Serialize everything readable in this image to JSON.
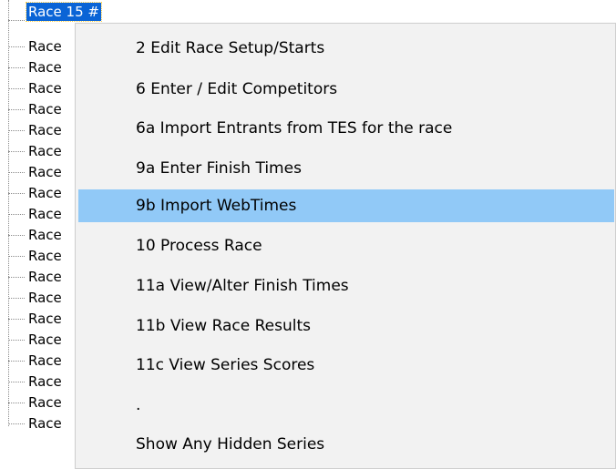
{
  "tree": {
    "selected_label": "Race 15 #",
    "item_label": "Race"
  },
  "context_menu": {
    "items": [
      {
        "label": "2  Edit Race Setup/Starts"
      },
      {
        "label": "6  Enter / Edit Competitors"
      },
      {
        "label": "6a  Import Entrants from TES for the race"
      },
      {
        "label": "9a  Enter Finish Times"
      },
      {
        "label": "9b Import WebTimes",
        "highlighted": true
      },
      {
        "label": "10  Process Race"
      },
      {
        "label": "11a  View/Alter Finish Times"
      },
      {
        "label": "11b  View Race Results"
      },
      {
        "label": "11c View Series Scores"
      },
      {
        "label": "."
      },
      {
        "label": "Show Any Hidden Series"
      }
    ],
    "highlight_color": "#91c9f7"
  }
}
